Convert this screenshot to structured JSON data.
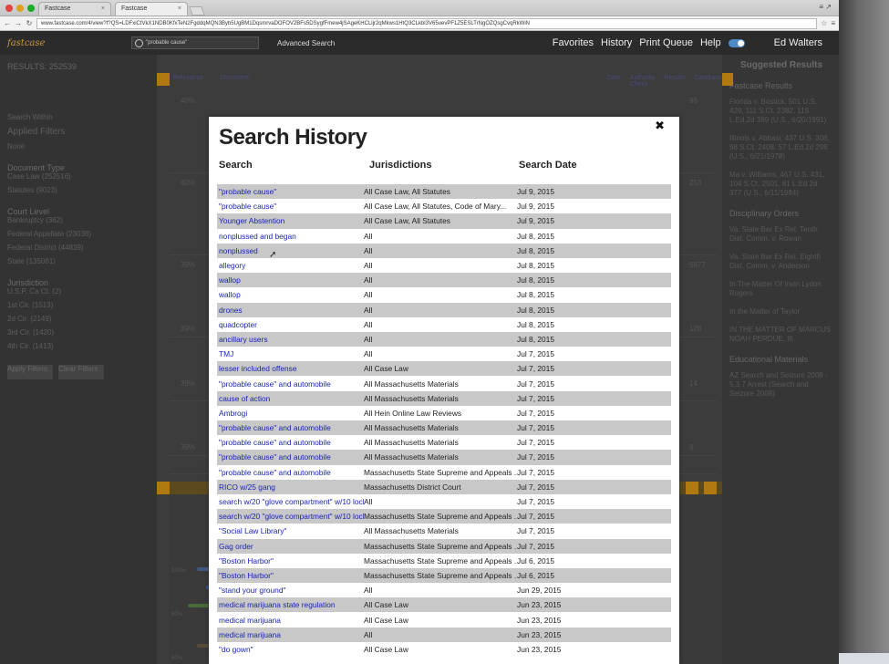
{
  "browser": {
    "tabs": [
      {
        "label": "Fastcase"
      },
      {
        "label": "Fastcase"
      }
    ],
    "url": "www.fastcase.com/4/view?f?QS=LDFxiCtVkX1NDB0KfxTeN2FgddqMQN3Byb5UgBM1DqsmrvaDOFOV2BFs5DSygfFmew4jSAgeKHCLljr2qMkws1HtQ3CLkbl3V65uevPF1Z5ESLTrNgOZQsgCvqRkWiN",
    "window_controls": "≡ ↗"
  },
  "header": {
    "logo": "fastcase",
    "search_value": "\"probable cause\"",
    "advanced_search": "Advanced Search",
    "nav": [
      "Favorites",
      "History",
      "Print Queue",
      "Help"
    ],
    "user": "Ed Walters"
  },
  "background": {
    "results_count": "RESULTS: 252539",
    "left_lines": [
      "Search Within",
      "Applied Filters",
      "None"
    ],
    "left_sections": [
      "Document Type",
      "Court Level",
      "Jurisdiction"
    ],
    "document_types": [
      "Case Law (252516)",
      "Statutes (9023)"
    ],
    "court_levels": [
      "Bankruptcy (362)",
      "Federal Appellate (23038)",
      "Federal District (44839)",
      "State (135081)"
    ],
    "jurisdictions": [
      "U.S.P. Ca Ct. (2)",
      "1st Cir. (1513)",
      "2d Cir. (2149)",
      "3rd Cir. (1420)",
      "4th Cir. (1413)"
    ],
    "left_buttons": [
      "Apply Filters",
      "Clear Filters"
    ],
    "mid_header": [
      "Relevance",
      "Document",
      "Date",
      "Authority Check",
      "Results",
      "Database"
    ],
    "mid_pcts": [
      "40%",
      "40%",
      "39%",
      "39%",
      "39%",
      "39%"
    ],
    "mid_numbers": [
      "96",
      "253",
      "5877",
      "128",
      "14",
      "8"
    ],
    "right_title": "Suggested Results",
    "right_sections": [
      "Fastcase Results",
      "Disciplinary Orders",
      "Educational Materials"
    ],
    "right_items": [
      "Florida v. Bostick, 501 U.S. 429, 111 S.Ct. 2382, 115 L.Ed.2d 389 (U.S., 6/20/1991)",
      "Illinois v. Abbasi, 437 U.S. 308, 98 S.Ct. 2408, 57 L.Ed.2d 298 (U.S., 6/21/1978)",
      "Ma v. Williams, 467 U.S. 431, 104 S.Ct. 2501, 81 L.Ed.2d 377 (U.S., 6/11/1984)"
    ],
    "right_disc": [
      "Va. State Bar Ex Rel. Tenth Dist. Comm. v. Rowan",
      "Va. State Bar Ex Rel. Eighth Dist. Comm. v. Anderson",
      "In The Matter Of Irwin Lydon Rogers",
      "In the Matter of Taylor",
      "IN THE MATTER OF MARCUS NOAH PERDUE, III"
    ],
    "right_edu": "AZ Search and Seizure 2008 - 5.3.7 Arrest (Search and Seizure 2008)",
    "viz_ticks": [
      "100%",
      "80%",
      "60%",
      "40%"
    ]
  },
  "modal": {
    "title": "Search History",
    "close_glyph": "✖",
    "columns": [
      "Search",
      "Jurisdictions",
      "Search Date"
    ],
    "rows": [
      {
        "search": "\"probable cause\"",
        "jurisdictions": "All Case Law, All Statutes",
        "date": "Jul 9, 2015"
      },
      {
        "search": "\"probable cause\"",
        "jurisdictions": "All Case Law, All Statutes, Code of Mary...",
        "date": "Jul 9, 2015"
      },
      {
        "search": "Younger Abstention",
        "jurisdictions": "All Case Law, All Statutes",
        "date": "Jul 9, 2015"
      },
      {
        "search": "nonplussed and began",
        "jurisdictions": "All",
        "date": "Jul 8, 2015"
      },
      {
        "search": "nonplussed",
        "jurisdictions": "All",
        "date": "Jul 8, 2015"
      },
      {
        "search": "allegory",
        "jurisdictions": "All",
        "date": "Jul 8, 2015"
      },
      {
        "search": "wallop",
        "jurisdictions": "All",
        "date": "Jul 8, 2015"
      },
      {
        "search": "wallop",
        "jurisdictions": "All",
        "date": "Jul 8, 2015"
      },
      {
        "search": "drones",
        "jurisdictions": "All",
        "date": "Jul 8, 2015"
      },
      {
        "search": "quadcopter",
        "jurisdictions": "All",
        "date": "Jul 8, 2015"
      },
      {
        "search": "ancillary users",
        "jurisdictions": "All",
        "date": "Jul 8, 2015"
      },
      {
        "search": "TMJ",
        "jurisdictions": "All",
        "date": "Jul 7, 2015"
      },
      {
        "search": "lesser included offense",
        "jurisdictions": "All Case Law",
        "date": "Jul 7, 2015"
      },
      {
        "search": "\"probable cause\" and automobile",
        "jurisdictions": "All Massachusetts Materials",
        "date": "Jul 7, 2015"
      },
      {
        "search": "cause of action",
        "jurisdictions": "All Massachusetts Materials",
        "date": "Jul 7, 2015"
      },
      {
        "search": "Ambrogi",
        "jurisdictions": "All Hein Online Law Reviews",
        "date": "Jul 7, 2015"
      },
      {
        "search": "\"probable cause\" and automobile",
        "jurisdictions": "All Massachusetts Materials",
        "date": "Jul 7, 2015"
      },
      {
        "search": "\"probable cause\" and automobile",
        "jurisdictions": "All Massachusetts Materials",
        "date": "Jul 7, 2015"
      },
      {
        "search": "\"probable cause\" and automobile",
        "jurisdictions": "All Massachusetts Materials",
        "date": "Jul 7, 2015"
      },
      {
        "search": "\"probable cause\" and automobile",
        "jurisdictions": "Massachusetts State Supreme and Appeals ...",
        "date": "Jul 7, 2015"
      },
      {
        "search": "RICO w/25 gang",
        "jurisdictions": "Massachusetts District Court",
        "date": "Jul 7, 2015"
      },
      {
        "search": "search w/20 \"glove compartment\" w/10 lock*",
        "jurisdictions": "All",
        "date": "Jul 7, 2015"
      },
      {
        "search": "search w/20 \"glove compartment\" w/10 lock*",
        "jurisdictions": "Massachusetts State Supreme and Appeals ...",
        "date": "Jul 7, 2015"
      },
      {
        "search": "\"Social Law Library\"",
        "jurisdictions": "All Massachusetts Materials",
        "date": "Jul 7, 2015"
      },
      {
        "search": "Gag order",
        "jurisdictions": "Massachusetts State Supreme and Appeals ...",
        "date": "Jul 7, 2015"
      },
      {
        "search": "\"Boston Harbor\"",
        "jurisdictions": "Massachusetts State Supreme and Appeals ...",
        "date": "Jul 6, 2015"
      },
      {
        "search": "\"Boston Harbor\"",
        "jurisdictions": "Massachusetts State Supreme and Appeals ...",
        "date": "Jul 6, 2015"
      },
      {
        "search": "\"stand your ground\"",
        "jurisdictions": "All",
        "date": "Jun 29, 2015"
      },
      {
        "search": "medical marijuana state regulation",
        "jurisdictions": "All Case Law",
        "date": "Jun 23, 2015"
      },
      {
        "search": "medical marijuana",
        "jurisdictions": "All Case Law",
        "date": "Jun 23, 2015"
      },
      {
        "search": "medical marijuana",
        "jurisdictions": "All",
        "date": "Jun 23, 2015"
      },
      {
        "search": "\"do gown\"",
        "jurisdictions": "All Case Law",
        "date": "Jun 23, 2015"
      }
    ]
  },
  "colors": {
    "link": "#1a24b4",
    "stripe": "#c8c8c8",
    "header_bg": "#2b2b2b",
    "accent_orange": "#b07a10"
  }
}
